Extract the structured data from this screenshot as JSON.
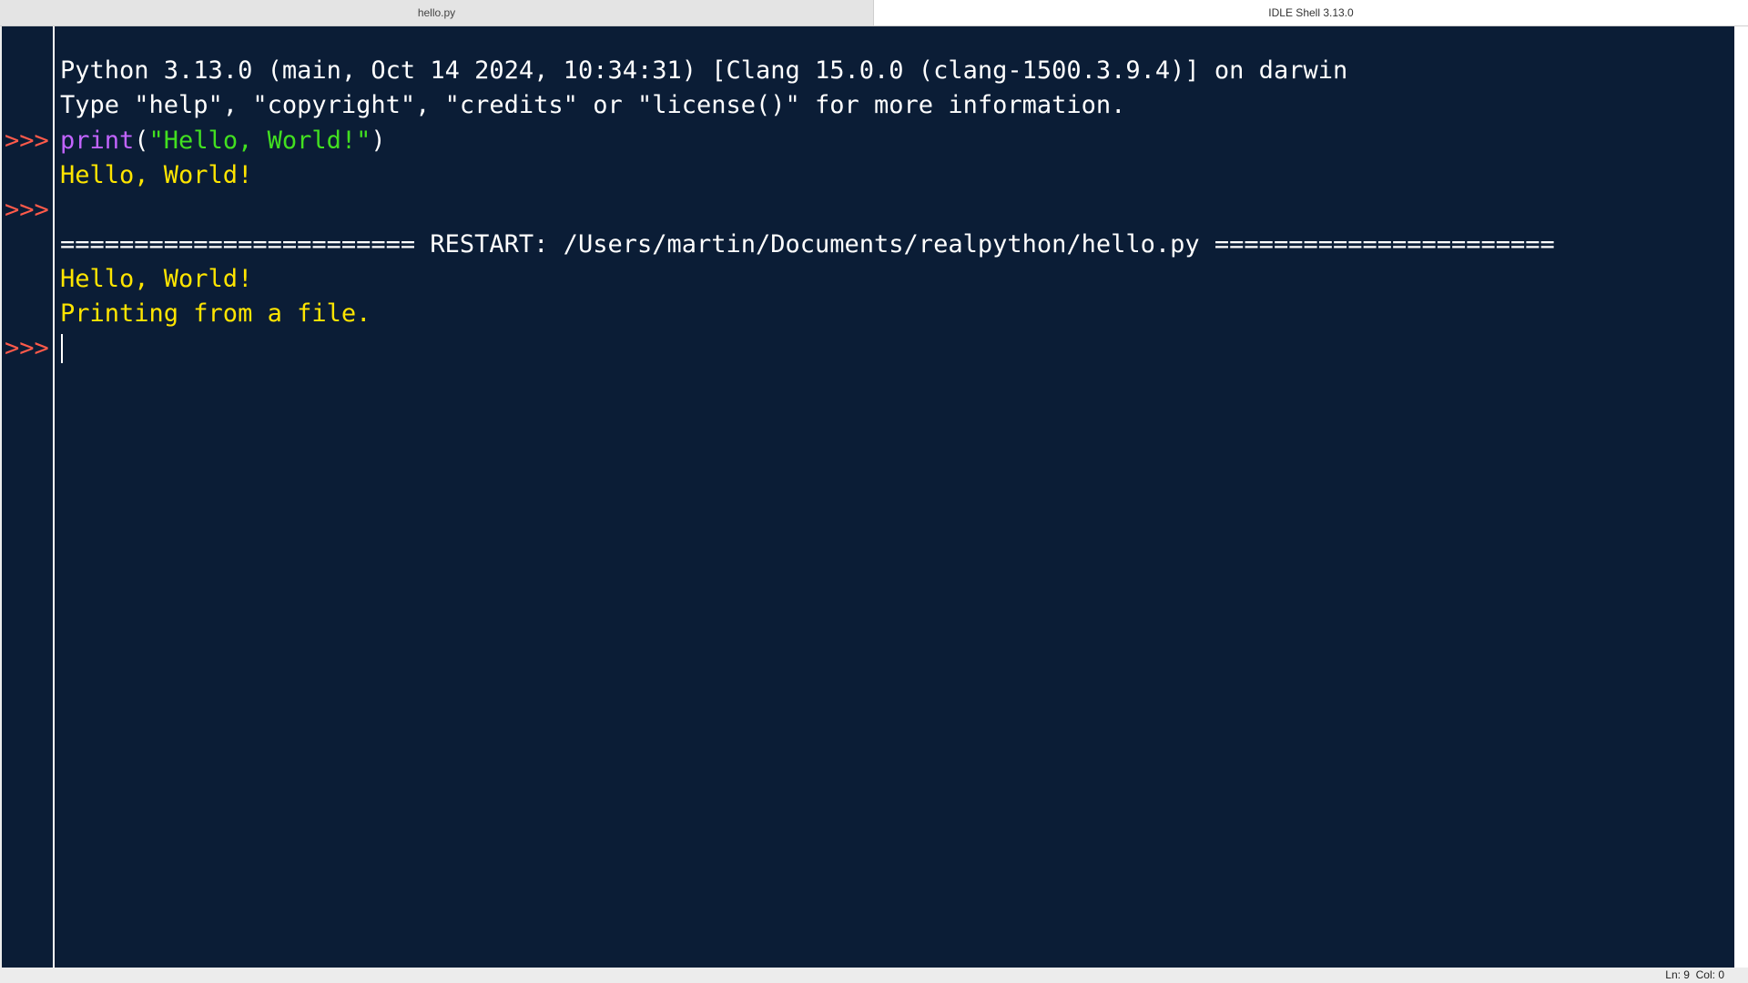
{
  "tabs": [
    {
      "label": "hello.py",
      "active": false
    },
    {
      "label": "IDLE Shell 3.13.0",
      "active": true
    }
  ],
  "shell": {
    "banner_line1": "Python 3.13.0 (main, Oct 14 2024, 10:34:31) [Clang 15.0.0 (clang-1500.3.9.4)] on darwin",
    "banner_line2": "Type \"help\", \"copyright\", \"credits\" or \"license()\" for more information.",
    "prompt": ">>>",
    "cmd_func": "print",
    "cmd_open": "(",
    "cmd_string": "\"Hello, World!\"",
    "cmd_close": ")",
    "output1": "Hello, World!",
    "restart_line": "======================== RESTART: /Users/martin/Documents/realpython/hello.py =======================",
    "output2": "Hello, World!",
    "output3": "Printing from a file."
  },
  "status": {
    "line_col": "Ln: 9  Col: 0"
  },
  "colors": {
    "background": "#0b1d36",
    "prompt": "#ff5a4a",
    "stdout": "#ffe500",
    "builtin": "#c264ff",
    "string": "#42e020",
    "text": "#ffffff"
  }
}
